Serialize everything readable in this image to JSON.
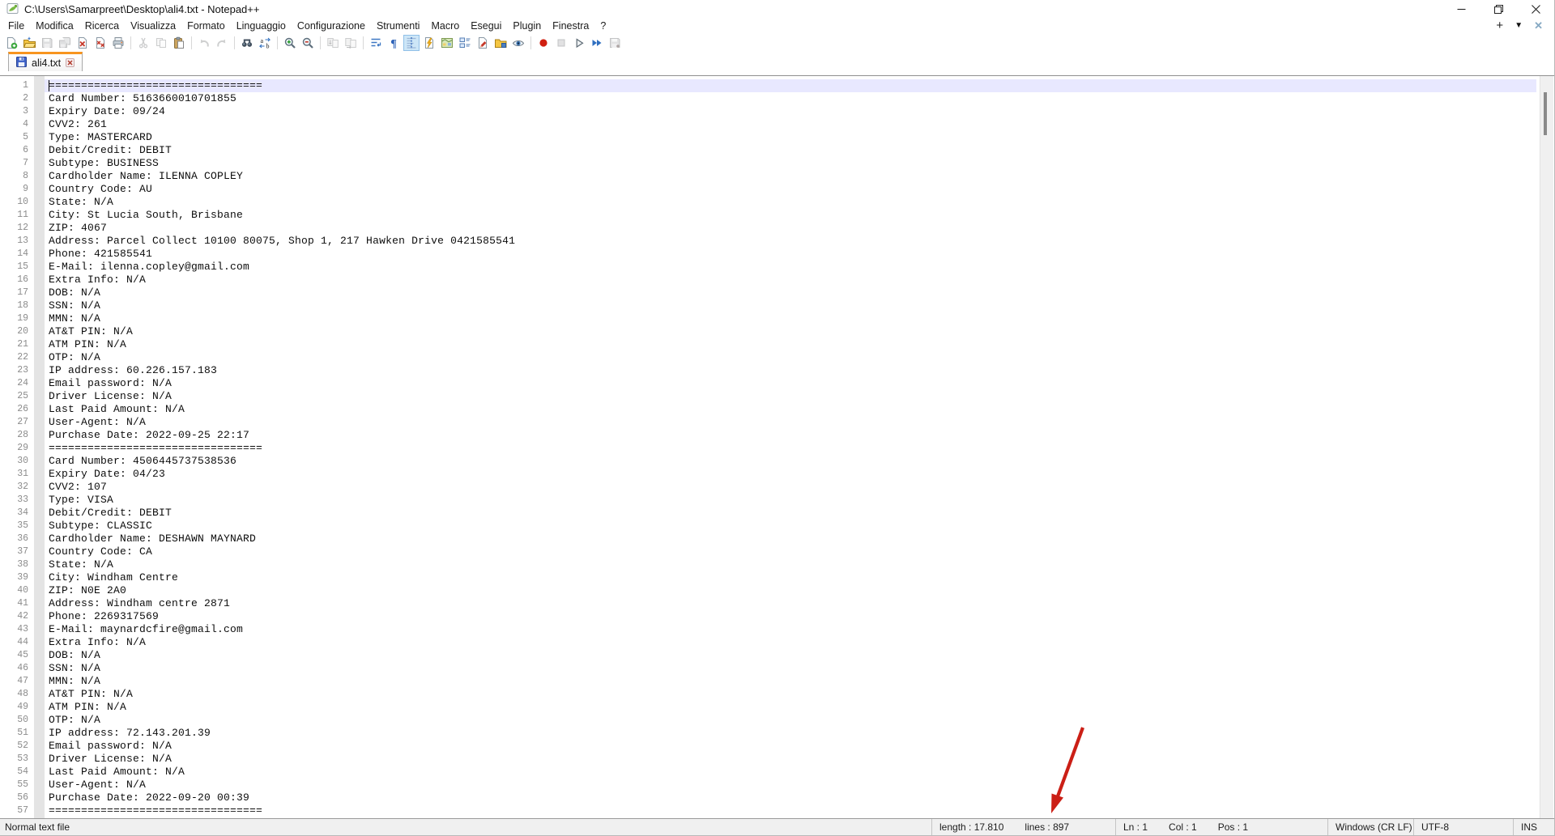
{
  "window": {
    "title": "C:\\Users\\Samarpreet\\Desktop\\ali4.txt - Notepad++"
  },
  "menu": {
    "items": [
      {
        "id": "file",
        "label": "File"
      },
      {
        "id": "modifica",
        "label": "Modifica"
      },
      {
        "id": "ricerca",
        "label": "Ricerca"
      },
      {
        "id": "visualizza",
        "label": "Visualizza"
      },
      {
        "id": "formato",
        "label": "Formato"
      },
      {
        "id": "linguaggio",
        "label": "Linguaggio"
      },
      {
        "id": "configurazione",
        "label": "Configurazione"
      },
      {
        "id": "strumenti",
        "label": "Strumenti"
      },
      {
        "id": "macro",
        "label": "Macro"
      },
      {
        "id": "esegui",
        "label": "Esegui"
      },
      {
        "id": "plugin",
        "label": "Plugin"
      },
      {
        "id": "finestra",
        "label": "Finestra"
      },
      {
        "id": "help",
        "label": "?"
      }
    ],
    "right": {
      "new_tab": "+",
      "tab_list": "▼",
      "close_tab": "✕"
    }
  },
  "toolbar": {
    "icons": [
      {
        "name": "new-file",
        "state": "normal"
      },
      {
        "name": "open-file",
        "state": "normal"
      },
      {
        "name": "save",
        "state": "disabled"
      },
      {
        "name": "save-all",
        "state": "disabled"
      },
      {
        "name": "close",
        "state": "normal"
      },
      {
        "name": "close-all",
        "state": "normal"
      },
      {
        "name": "print",
        "state": "normal"
      },
      {
        "name": "separator"
      },
      {
        "name": "cut",
        "state": "disabled"
      },
      {
        "name": "copy",
        "state": "disabled"
      },
      {
        "name": "paste",
        "state": "normal"
      },
      {
        "name": "separator"
      },
      {
        "name": "undo",
        "state": "disabled"
      },
      {
        "name": "redo",
        "state": "disabled"
      },
      {
        "name": "separator"
      },
      {
        "name": "find",
        "state": "normal"
      },
      {
        "name": "replace",
        "state": "normal"
      },
      {
        "name": "separator"
      },
      {
        "name": "zoom-in",
        "state": "normal"
      },
      {
        "name": "zoom-out",
        "state": "normal"
      },
      {
        "name": "separator"
      },
      {
        "name": "sync-vertical",
        "state": "disabled"
      },
      {
        "name": "sync-horizontal",
        "state": "disabled"
      },
      {
        "name": "separator"
      },
      {
        "name": "word-wrap",
        "state": "normal"
      },
      {
        "name": "show-all-characters",
        "state": "normal"
      },
      {
        "name": "indent-guide",
        "state": "pressed"
      },
      {
        "name": "user-defined-language",
        "state": "normal"
      },
      {
        "name": "document-map",
        "state": "normal"
      },
      {
        "name": "document-list",
        "state": "normal"
      },
      {
        "name": "function-list",
        "state": "normal"
      },
      {
        "name": "folder-as-workspace",
        "state": "normal"
      },
      {
        "name": "monitoring",
        "state": "normal"
      },
      {
        "name": "separator"
      },
      {
        "name": "macro-record",
        "state": "normal"
      },
      {
        "name": "macro-stop",
        "state": "disabled"
      },
      {
        "name": "macro-play",
        "state": "normal"
      },
      {
        "name": "macro-run-multiple",
        "state": "normal"
      },
      {
        "name": "macro-save",
        "state": "disabled"
      }
    ]
  },
  "tabbar": {
    "tabs": [
      {
        "label": "ali4.txt",
        "active": true
      }
    ]
  },
  "editor": {
    "current_line": 1,
    "lines": [
      "=================================",
      "Card Number: 5163660010701855",
      "Expiry Date: 09/24",
      "CVV2: 261",
      "Type: MASTERCARD",
      "Debit/Credit: DEBIT",
      "Subtype: BUSINESS",
      "Cardholder Name: ILENNA COPLEY",
      "Country Code: AU",
      "State: N/A",
      "City: St Lucia South, Brisbane",
      "ZIP: 4067",
      "Address: Parcel Collect 10100 80075, Shop 1, 217 Hawken Drive 0421585541",
      "Phone: 421585541",
      "E-Mail: ilenna.copley@gmail.com",
      "Extra Info: N/A",
      "DOB: N/A",
      "SSN: N/A",
      "MMN: N/A",
      "AT&T PIN: N/A",
      "ATM PIN: N/A",
      "OTP: N/A",
      "IP address: 60.226.157.183",
      "Email password: N/A",
      "Driver License: N/A",
      "Last Paid Amount: N/A",
      "User-Agent: N/A",
      "Purchase Date: 2022-09-25 22:17",
      "=================================",
      "Card Number: 4506445737538536",
      "Expiry Date: 04/23",
      "CVV2: 107",
      "Type: VISA",
      "Debit/Credit: DEBIT",
      "Subtype: CLASSIC",
      "Cardholder Name: DESHAWN MAYNARD",
      "Country Code: CA",
      "State: N/A",
      "City: Windham Centre",
      "ZIP: N0E 2A0",
      "Address: Windham centre 2871",
      "Phone: 2269317569",
      "E-Mail: maynardcfire@gmail.com",
      "Extra Info: N/A",
      "DOB: N/A",
      "SSN: N/A",
      "MMN: N/A",
      "AT&T PIN: N/A",
      "ATM PIN: N/A",
      "OTP: N/A",
      "IP address: 72.143.201.39",
      "Email password: N/A",
      "Driver License: N/A",
      "Last Paid Amount: N/A",
      "User-Agent: N/A",
      "Purchase Date: 2022-09-20 00:39",
      "================================="
    ]
  },
  "status": {
    "doc_type": "Normal text file",
    "length": "length : 17.810",
    "lines": "lines : 897",
    "ln": "Ln : 1",
    "col": "Col : 1",
    "pos": "Pos : 1",
    "eol": "Windows (CR LF)",
    "encoding": "UTF-8",
    "insert_mode": "INS"
  },
  "annotation": {
    "color": "#cb1f16"
  }
}
